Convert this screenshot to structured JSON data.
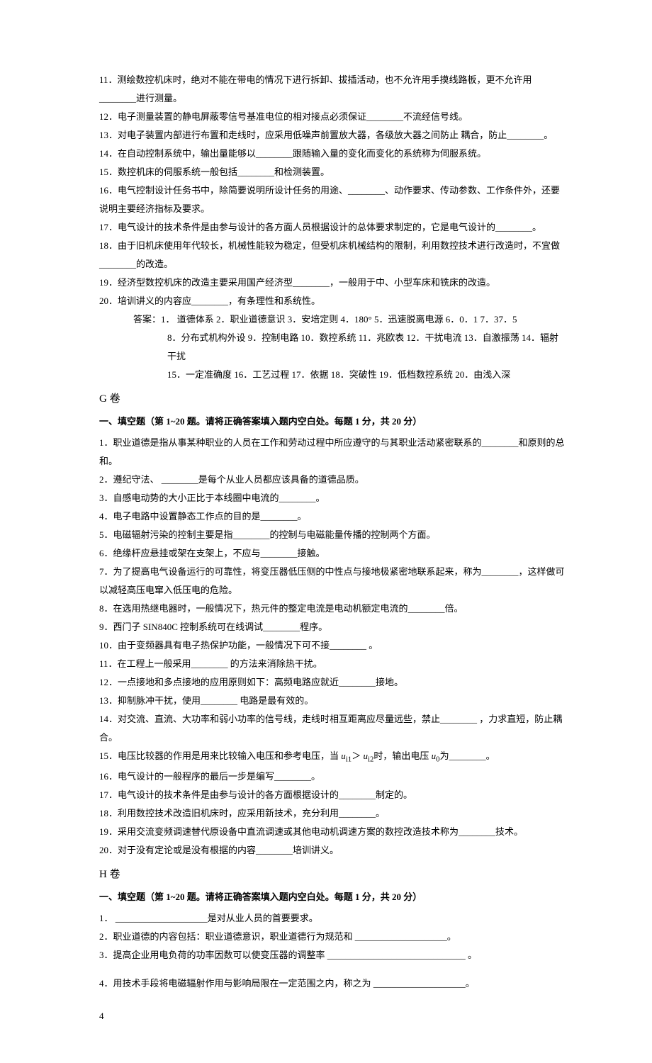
{
  "top": {
    "q11": "11．测绘数控机床时，绝对不能在带电的情况下进行拆卸、拔插活动，也不允许用手摸线路板，更不允许用________进行测量。",
    "q12": "12．电子测量装置的静电屏蔽零信号基准电位的相对接点必须保证________不流经信号线。",
    "q13": "13．对电子装置内部进行布置和走线时，应采用低噪声前置放大器，各级放大器之间防止 耦合，防止________。",
    "q14": "14．在自动控制系统中，输出量能够以________跟随输入量的变化而变化的系统称为伺服系统。",
    "q15": "15．数控机床的伺服系统一般包括________和检测装置。",
    "q16": "16．电气控制设计任务书中，除简要说明所设计任务的用途、________、动作要求、传动参数、工作条件外，还要说明主要经济指标及要求。",
    "q17": "17．电气设计的技术条件是由参与设计的各方面人员根据设计的总体要求制定的，它是电气设计的________。",
    "q18": "18．由于旧机床使用年代较长，机械性能较为稳定，但受机床机械结构的限制，利用数控技术进行改造时，不宜做________的改造。",
    "q19": "19．经济型数控机床的改造主要采用国产经济型________，一般用于中、小型车床和铣床的改造。",
    "q20": "20．培训讲义的内容应________，有条理性和系统性。",
    "ans1": "答案：1． 道德体系  2．职业道德意识  3．安培定则   4．180°    5．迅速脱离电源    6．0．1    7．37．5",
    "ans2": "8．分布式机构外设  9．控制电路  10．数控系统 11．兆欧表 12．干扰电流 13．自激振荡 14．辐射干扰",
    "ans3": "15．一定准确度 16．工艺过程   17．依据 18．突破性 19．低档数控系统 20．由浅入深"
  },
  "g": {
    "title": "G 卷",
    "sub": "一、填空题（第 1~20 题。请将正确答案填入题内空白处。每题 1 分，共 20 分）",
    "q1": "1．职业道德是指从事某种职业的人员在工作和劳动过程中所应遵守的与其职业活动紧密联系的________和原则的总和。",
    "q2": "2．遵纪守法、 ________是每个从业人员都应该具备的道德品质。",
    "q3": "3．自感电动势的大小正比于本线圈中电流的________。",
    "q4": "4．电子电路中设置静态工作点的目的是________。",
    "q5": "5．电磁辐射污染的控制主要是指________的控制与电磁能量传播的控制两个方面。",
    "q6": "6．绝缘杆应悬挂或架在支架上，不应与________接触。",
    "q7": "7．为了提高电气设备运行的可靠性，将变压器低压侧的中性点与接地极紧密地联系起来，称为________，这样做可以减轻高压电窜入低压电的危险。",
    "q8": "8．在选用热继电器时，一般情况下，热元件的整定电流是电动机额定电流的________倍。",
    "q9": "9．西门子 SIN840C 控制系统可在线调试________程序。",
    "q10": "10．由于变频器具有电子热保护功能，一般情况下可不接________ 。",
    "q11": "11．在工程上一般采用________ 的方法来消除热干扰。",
    "q12": "12．一点接地和多点接地的应用原则如下：高频电路应就近________接地。",
    "q13": "13．抑制脉冲干扰，使用________ 电路是最有效的。",
    "q14": "14．对交流、直流、大功率和弱小功率的信号线，走线时相互距离应尽量远些，禁止________ ，力求直短，防止耦合。",
    "q15_a": "15．电压比较器的作用是用来比较输入电压和参考电压，当 ",
    "q15_uil": "u",
    "q15_i1": "i1",
    "q15_gt": "＞ ",
    "q15_ui2": "u",
    "q15_i2": "i2",
    "q15_mid": "时，输出电压 ",
    "q15_u0": "u",
    "q15_0": "0",
    "q15_end": "为________。",
    "q16": "16．电气设计的一般程序的最后一步是编写________。",
    "q17": "17．电气设计的技术条件是由参与设计的各方面根据设计的________制定的。",
    "q18": "18．利用数控技术改造旧机床时，应采用新技术，充分利用________。",
    "q19": "19．采用交流变频调速替代原设备中直流调速或其他电动机调速方案的数控改造技术称为________技术。",
    "q20": "20．对于没有定论或是没有根据的内容________培训讲义。"
  },
  "h": {
    "title": "H 卷",
    "sub": "一、填空题（第 1~20 题。请将正确答案填入题内空白处。每题 1 分，共 20 分）",
    "q1": "1． ____________________是对从业人员的首要要求。",
    "q2": "2．职业道德的内容包括：职业道德意识，职业道德行为规范和   ____________________。",
    "q3": "3．提高企业用电负荷的功率因数可以使变压器的调整率   ______________________________  。",
    "q4": "4．用技术手段将电磁辐射作用与影响局限在一定范围之内，称之为   ____________________。"
  },
  "pagenum": "4"
}
